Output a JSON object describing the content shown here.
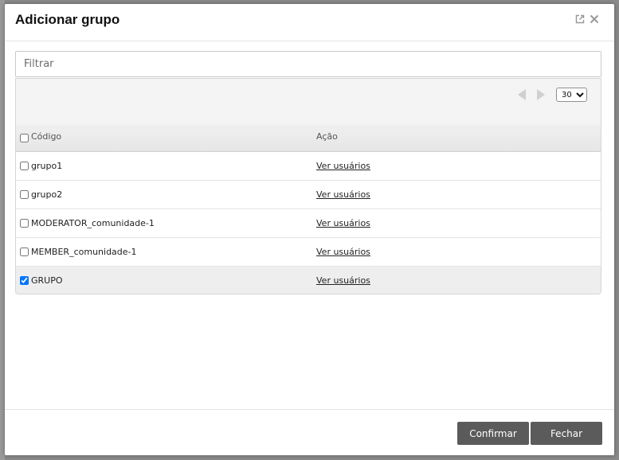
{
  "dialog": {
    "title": "Adicionar grupo",
    "icons": [
      "external-link-icon",
      "close-icon"
    ]
  },
  "filter": {
    "placeholder": "Filtrar",
    "value": ""
  },
  "pager": {
    "page_size": "30",
    "page_size_options": [
      "30"
    ]
  },
  "table": {
    "columns": {
      "code": "Código",
      "action": "Ação"
    },
    "rows": [
      {
        "code": "grupo1",
        "action": "Ver usuários",
        "checked": false
      },
      {
        "code": "grupo2",
        "action": "Ver usuários",
        "checked": false
      },
      {
        "code": "MODERATOR_comunidade-1",
        "action": "Ver usuários",
        "checked": false
      },
      {
        "code": "MEMBER_comunidade-1",
        "action": "Ver usuários",
        "checked": false
      },
      {
        "code": "GRUPO",
        "action": "Ver usuários",
        "checked": true
      }
    ]
  },
  "footer": {
    "confirm_label": "Confirmar",
    "close_label": "Fechar"
  },
  "colors": {
    "button_bg": "#5b5b5b",
    "selected_row": "#eeeeee",
    "header_bg": "#f4f4f4"
  }
}
